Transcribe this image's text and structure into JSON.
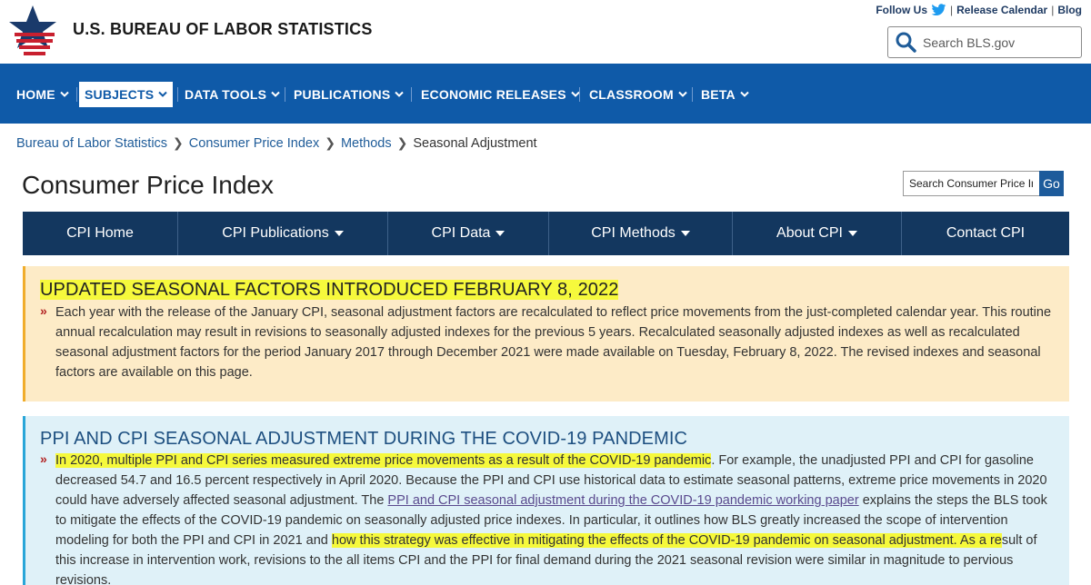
{
  "header": {
    "org_name": "U.S. BUREAU OF LABOR STATISTICS",
    "follow_us": "Follow Us",
    "sep": "|",
    "release_calendar": "Release Calendar",
    "blog": "Blog",
    "search_placeholder": "Search BLS.gov"
  },
  "nav": {
    "items": [
      {
        "label": "HOME"
      },
      {
        "label": "SUBJECTS"
      },
      {
        "label": "DATA TOOLS"
      },
      {
        "label": "PUBLICATIONS"
      },
      {
        "label": "ECONOMIC RELEASES"
      },
      {
        "label": "CLASSROOM"
      },
      {
        "label": "BETA"
      }
    ]
  },
  "breadcrumb": {
    "items": [
      "Bureau of Labor Statistics",
      "Consumer Price Index",
      "Methods",
      "Seasonal Adjustment"
    ]
  },
  "page": {
    "title": "Consumer Price Index",
    "search_placeholder": "Search Consumer Price Index",
    "go_label": "Go"
  },
  "cpi_nav": {
    "tabs": [
      {
        "label": "CPI Home"
      },
      {
        "label": "CPI Publications"
      },
      {
        "label": "CPI Data"
      },
      {
        "label": "CPI Methods"
      },
      {
        "label": "About CPI"
      },
      {
        "label": "Contact CPI"
      }
    ]
  },
  "notice1": {
    "heading": "UPDATED SEASONAL FACTORS INTRODUCED FEBRUARY 8, 2022",
    "marker": "»",
    "text": "Each year with the release of the January CPI, seasonal adjustment factors are recalculated to reflect price movements from the just-completed calendar year. This routine annual recalculation may result in revisions to seasonally adjusted indexes for the previous 5 years. Recalculated seasonally adjusted indexes as well as recalculated seasonal adjustment factors for the period January 2017 through December 2021 were made available on Tuesday, February 8, 2022. The revised indexes and seasonal factors are available on this page."
  },
  "notice2": {
    "heading": "PPI AND CPI SEASONAL ADJUSTMENT DURING THE COVID-19 PANDEMIC",
    "marker": "»",
    "hl1": "In 2020, multiple PPI and CPI series measured extreme price movements as a result of the COVID-19 pandemic",
    "t1": ". For example, the unadjusted PPI and CPI for gasoline decreased 54.7 and 16.5 percent respectively in April 2020. Because the PPI and CPI use historical data to estimate seasonal patterns, extreme price movements in 2020 could have adversely affected seasonal adjustment. The ",
    "link": "PPI and CPI seasonal adjustment during the COVID-19 pandemic working paper",
    "t2": " explains the steps the BLS took to mitigate the effects of the COVID-19 pandemic on seasonally adjusted price indexes. In particular, it outlines how BLS greatly increased the scope of intervention modeling for both the PPI and CPI in 2021 and ",
    "hl2": "how this strategy was effective in mitigating the effects of the COVID-19 pandemic on seasonal adjustment. As a re",
    "t3": "sult of this increase in intervention work, revisions to the all items CPI and the PPI for final demand during the 2021 seasonal revision were similar in magnitude to pervious revisions."
  },
  "colors": {
    "nav_blue": "#0f5aa8",
    "cpi_nav_navy": "#13375f",
    "notice1_bg": "#fdebc7",
    "notice2_bg": "#dff1f8",
    "highlight": "#f6f93c"
  }
}
